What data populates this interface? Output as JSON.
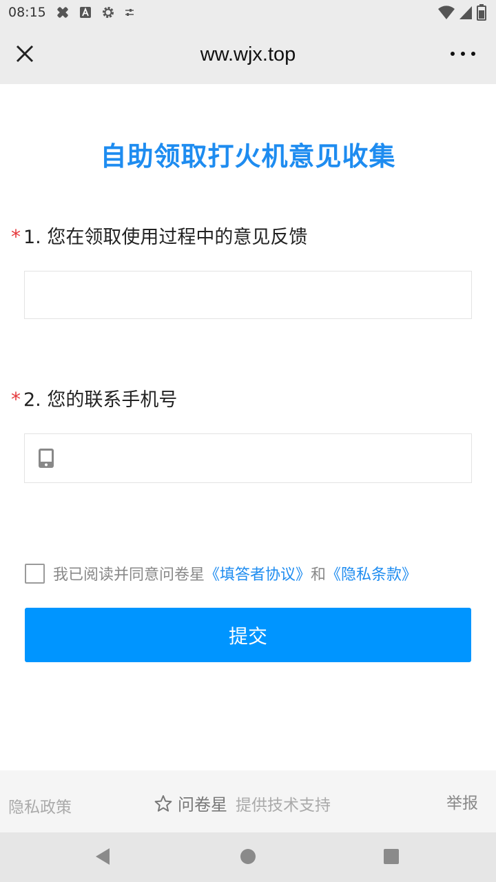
{
  "status_bar": {
    "time": "08:15",
    "icons": [
      "medical-icon",
      "font-a-icon",
      "settings-icon",
      "tune-icon",
      "wifi-icon",
      "signal-icon",
      "battery-icon"
    ]
  },
  "browser": {
    "url": "ww.wjx.top",
    "close_icon": "close-icon",
    "menu_icon": "more-icon"
  },
  "survey": {
    "title": "自助领取打火机意见收集",
    "questions": [
      {
        "required_mark": "*",
        "label": "1. 您在领取使用过程中的意见反馈",
        "value": ""
      },
      {
        "required_mark": "*",
        "label": "2. 您的联系手机号",
        "value": ""
      }
    ],
    "agreement": {
      "checked": false,
      "prefix": "我已阅读并同意问卷星",
      "link1": "《填答者协议》",
      "conj": "和",
      "link2": "《隐私条款》"
    },
    "submit_label": "提交"
  },
  "footer": {
    "privacy": "隐私政策",
    "brand": "问卷星",
    "brand_sub": "提供技术支持",
    "report": "举报"
  },
  "colors": {
    "accent": "#0095ff",
    "title": "#1e8cf0",
    "required": "#e5393c"
  }
}
